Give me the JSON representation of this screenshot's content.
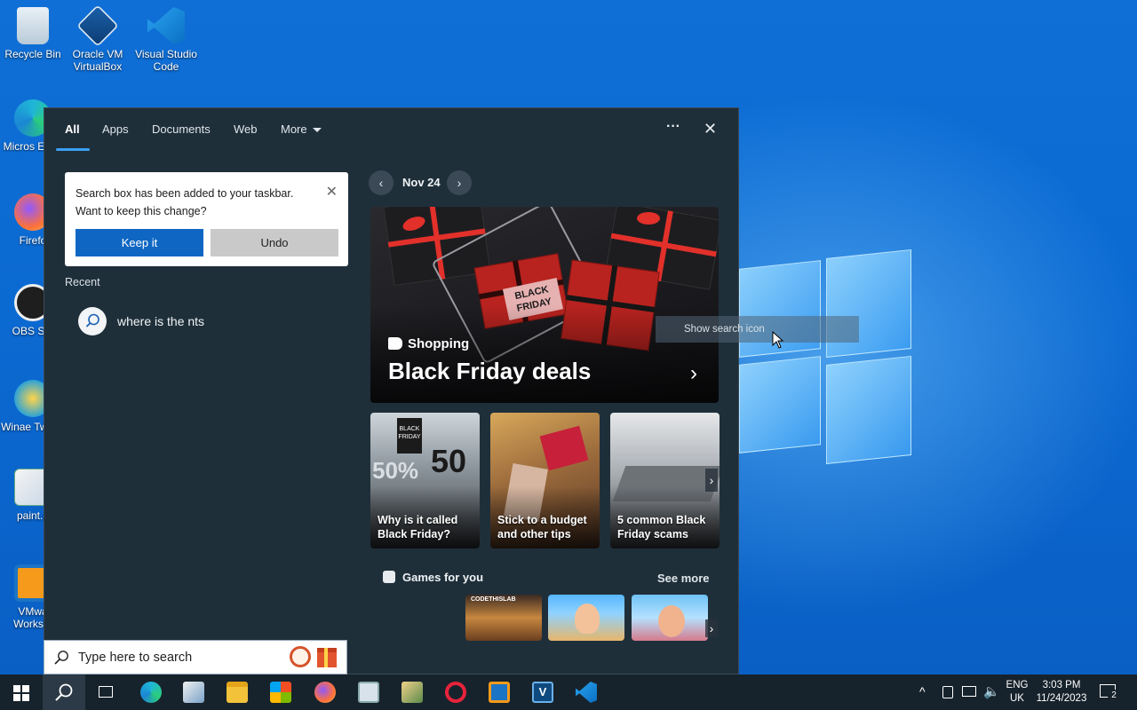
{
  "desktop": {
    "icons": [
      {
        "label": "Recycle Bin"
      },
      {
        "label": "Oracle VM VirtualBox"
      },
      {
        "label": "Visual Studio Code"
      },
      {
        "label": "Micros Edge"
      },
      {
        "label": "Firefo"
      },
      {
        "label": "OBS Stu"
      },
      {
        "label": "Winae Tweak"
      },
      {
        "label": "paint.n"
      },
      {
        "label": "VMwa Worksta"
      }
    ]
  },
  "search_panel": {
    "tabs": [
      {
        "label": "All",
        "active": true
      },
      {
        "label": "Apps"
      },
      {
        "label": "Documents"
      },
      {
        "label": "Web"
      },
      {
        "label": "More"
      }
    ],
    "options_label": "···",
    "close_label": "✕",
    "toast": {
      "message_line1": "Search box has been added to your taskbar.",
      "message_line2": "Want to keep this change?",
      "keep_label": "Keep it",
      "undo_label": "Undo",
      "close_label": "✕"
    },
    "recent": {
      "heading": "Recent",
      "items": [
        {
          "text": "where is the nts"
        }
      ]
    },
    "date_nav": {
      "label": "Nov 24",
      "prev": "‹",
      "next": "›"
    },
    "hero": {
      "category": "Shopping",
      "title": "Black Friday deals",
      "tag_text": "BLACK FRIDAY",
      "chevron": "›"
    },
    "cards": [
      {
        "caption": "Why is it called Black Friday?",
        "sign_text": "BLACK FRIDAY",
        "big_text": "50",
        "pct_text": "50%"
      },
      {
        "caption": "Stick to a budget and other tips"
      },
      {
        "caption": "5 common Black Friday scams"
      }
    ],
    "games": {
      "heading": "Games for you",
      "see_more": "See more",
      "tile1_text": "CODETHISLAB"
    }
  },
  "tooltip": {
    "text": "Show search icon"
  },
  "search_box": {
    "placeholder": "Type here to search"
  },
  "taskbar": {
    "apps": [
      "start",
      "search",
      "task-view",
      "edge",
      "paint",
      "file-explorer",
      "store",
      "firefox",
      "app-9",
      "app-10",
      "opera",
      "virtualbox",
      "visio",
      "vscode"
    ],
    "language_line1": "ENG",
    "language_line2": "UK",
    "time": "3:03 PM",
    "date": "11/24/2023",
    "notification_count": "2"
  },
  "colors": {
    "accent": "#0f67c3",
    "panel_bg": "#1f2f3a",
    "taskbar_bg": "#17232c",
    "tab_underline": "#3aa0f3"
  }
}
